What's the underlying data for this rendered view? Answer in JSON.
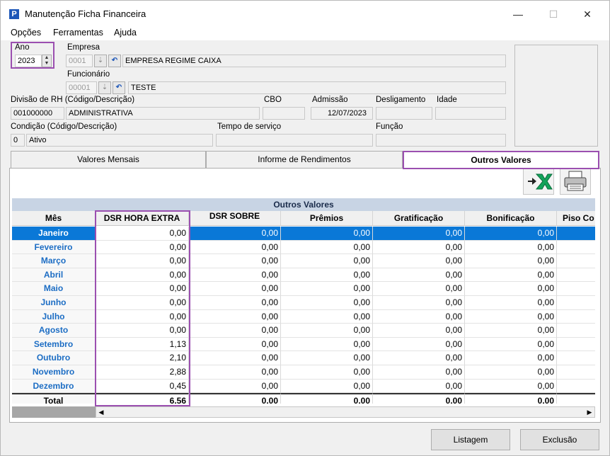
{
  "window": {
    "title": "Manutenção Ficha Financeira",
    "app_icon": "P",
    "minimize": "—",
    "maximize": "☐",
    "close": "✕"
  },
  "menu": [
    "Opções",
    "Ferramentas",
    "Ajuda"
  ],
  "form": {
    "ano_label": "Ano",
    "ano_value": "2023",
    "empresa_label": "Empresa",
    "empresa_code": "0001",
    "empresa_name": "EMPRESA REGIME CAIXA",
    "funcionario_label": "Funcionário",
    "funcionario_code": "00001",
    "funcionario_name": "TESTE",
    "divisao_label": "Divisão de RH (Código/Descrição)",
    "divisao_code": "001000000",
    "divisao_name": "ADMINISTRATIVA",
    "cbo_label": "CBO",
    "cbo_value": "",
    "admissao_label": "Admissão",
    "admissao_value": "12/07/2023",
    "desligamento_label": "Desligamento",
    "desligamento_value": "",
    "idade_label": "Idade",
    "idade_value": "",
    "condicao_label": "Condição (Código/Descrição)",
    "condicao_code": "0",
    "condicao_name": "Ativo",
    "tempo_label": "Tempo de serviço",
    "tempo_value": "",
    "funcao_label": "Função",
    "funcao_value": ""
  },
  "tabs": [
    "Valores Mensais",
    "Informe de Rendimentos",
    "Outros Valores"
  ],
  "toolbar": {
    "excel_icon": "excel-export-icon",
    "print_icon": "printer-icon"
  },
  "grid": {
    "banner": "Outros Valores",
    "columns": [
      "Mês",
      "DSR HORA EXTRA",
      "DSR SOBRE",
      "Prêmios",
      "Gratificação",
      "Bonificação",
      "Piso Co"
    ],
    "rows": [
      {
        "mes": "Janeiro",
        "v": [
          "0,00",
          "0,00",
          "0,00",
          "0,00",
          "0,00",
          ""
        ]
      },
      {
        "mes": "Fevereiro",
        "v": [
          "0,00",
          "0,00",
          "0,00",
          "0,00",
          "0,00",
          ""
        ]
      },
      {
        "mes": "Março",
        "v": [
          "0,00",
          "0,00",
          "0,00",
          "0,00",
          "0,00",
          ""
        ]
      },
      {
        "mes": "Abril",
        "v": [
          "0,00",
          "0,00",
          "0,00",
          "0,00",
          "0,00",
          ""
        ]
      },
      {
        "mes": "Maio",
        "v": [
          "0,00",
          "0,00",
          "0,00",
          "0,00",
          "0,00",
          ""
        ]
      },
      {
        "mes": "Junho",
        "v": [
          "0,00",
          "0,00",
          "0,00",
          "0,00",
          "0,00",
          ""
        ]
      },
      {
        "mes": "Julho",
        "v": [
          "0,00",
          "0,00",
          "0,00",
          "0,00",
          "0,00",
          ""
        ]
      },
      {
        "mes": "Agosto",
        "v": [
          "0,00",
          "0,00",
          "0,00",
          "0,00",
          "0,00",
          ""
        ]
      },
      {
        "mes": "Setembro",
        "v": [
          "1,13",
          "0,00",
          "0,00",
          "0,00",
          "0,00",
          ""
        ]
      },
      {
        "mes": "Outubro",
        "v": [
          "2,10",
          "0,00",
          "0,00",
          "0,00",
          "0,00",
          ""
        ]
      },
      {
        "mes": "Novembro",
        "v": [
          "2,88",
          "0,00",
          "0,00",
          "0,00",
          "0,00",
          ""
        ]
      },
      {
        "mes": "Dezembro",
        "v": [
          "0,45",
          "0,00",
          "0,00",
          "0,00",
          "0,00",
          ""
        ]
      }
    ],
    "total": {
      "mes": "Total",
      "v": [
        "6,56",
        "0,00",
        "0,00",
        "0,00",
        "0,00",
        ""
      ]
    }
  },
  "buttons": {
    "listagem": "Listagem",
    "exclusao": "Exclusão"
  },
  "colors": {
    "accent": "#0a78d7",
    "highlight": "#9b4fb0",
    "month_text": "#1c6dc4"
  }
}
